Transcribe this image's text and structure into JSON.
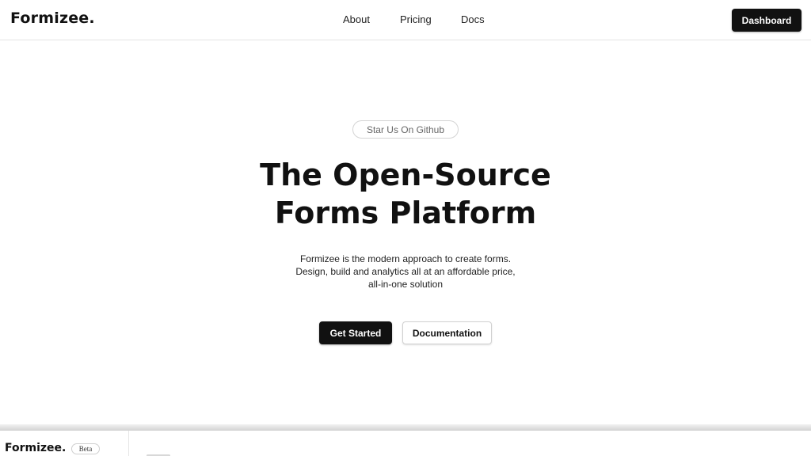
{
  "navbar": {
    "brand": "Formizee.",
    "links": [
      {
        "label": "About"
      },
      {
        "label": "Pricing"
      },
      {
        "label": "Docs"
      }
    ],
    "dashboard_label": "Dashboard"
  },
  "hero": {
    "star_label": "Star Us On Github",
    "title_line1": "The Open-Source",
    "title_line2": "Forms Platform",
    "desc_line1": "Formizee is the modern approach to create forms.",
    "desc_line2": "Design, build and analytics all at an affordable price,",
    "desc_line3": "all-in-one solution",
    "cta_primary": "Get Started",
    "cta_secondary": "Documentation"
  },
  "preview": {
    "brand": "Formizee.",
    "badge": "Beta"
  },
  "colors": {
    "primary": "#111111",
    "border": "#e4e4e4",
    "background": "#ffffff"
  }
}
